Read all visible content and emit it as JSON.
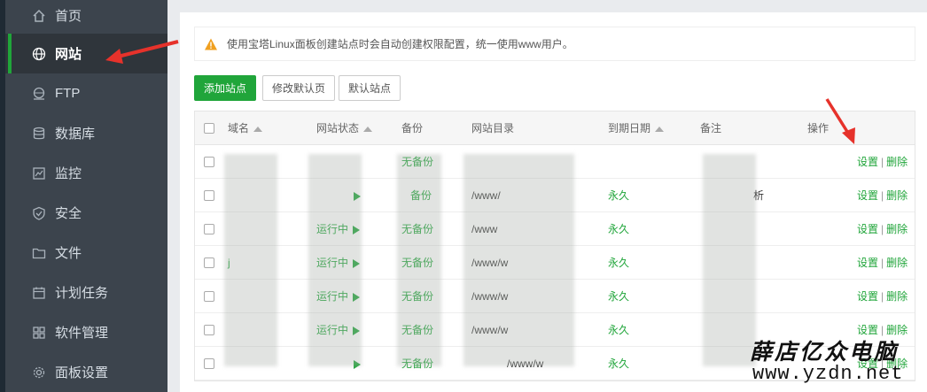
{
  "sidebar": {
    "items": [
      {
        "label": "首页",
        "icon": "home-icon"
      },
      {
        "label": "网站",
        "icon": "globe-icon",
        "active": true
      },
      {
        "label": "FTP",
        "icon": "ftp-icon"
      },
      {
        "label": "数据库",
        "icon": "database-icon"
      },
      {
        "label": "监控",
        "icon": "monitor-icon"
      },
      {
        "label": "安全",
        "icon": "shield-icon"
      },
      {
        "label": "文件",
        "icon": "folder-icon"
      },
      {
        "label": "计划任务",
        "icon": "calendar-icon"
      },
      {
        "label": "软件管理",
        "icon": "grid-icon"
      },
      {
        "label": "面板设置",
        "icon": "gear-icon"
      }
    ]
  },
  "notice": {
    "text": "使用宝塔Linux面板创建站点时会自动创建权限配置，统一使用www用户。"
  },
  "toolbar": {
    "add_site": "添加站点",
    "edit_default_page": "修改默认页",
    "default_site": "默认站点"
  },
  "table": {
    "headers": {
      "name": "域名",
      "status": "网站状态",
      "backup": "备份",
      "dir": "网站目录",
      "expire": "到期日期",
      "remark": "备注",
      "ops": "操作"
    },
    "rows": [
      {
        "name": "",
        "status": "",
        "backup": "无备份",
        "dir": "",
        "expire": "",
        "remark": ""
      },
      {
        "name": "",
        "status": "",
        "backup": "备份",
        "dir": "/www/",
        "expire": "永久",
        "remark": "析"
      },
      {
        "name": "",
        "status": "运行中",
        "backup": "无备份",
        "dir": "/www",
        "expire": "永久",
        "remark": ""
      },
      {
        "name": "j",
        "status": "运行中",
        "backup": "无备份",
        "dir": "/www/w",
        "expire": "永久",
        "remark": ""
      },
      {
        "name": "",
        "status": "运行中",
        "backup": "无备份",
        "dir": "/www/w",
        "expire": "永久",
        "remark": ""
      },
      {
        "name": "",
        "status": "运行中",
        "backup": "无备份",
        "dir": "/www/w",
        "expire": "永久",
        "remark": ""
      },
      {
        "name": "",
        "status": "",
        "backup": "无备份",
        "dir": "/www/w",
        "expire": "永久",
        "remark": ""
      }
    ],
    "op_settings": "设置",
    "op_delete": "删除",
    "op_separator": "|"
  },
  "watermark": {
    "line1": "薛店亿众电脑",
    "line2": "www.yzdn.net"
  },
  "colors": {
    "accent": "#20a53a",
    "sidebar_bg": "#3c444d",
    "annotation": "#e6322b"
  }
}
